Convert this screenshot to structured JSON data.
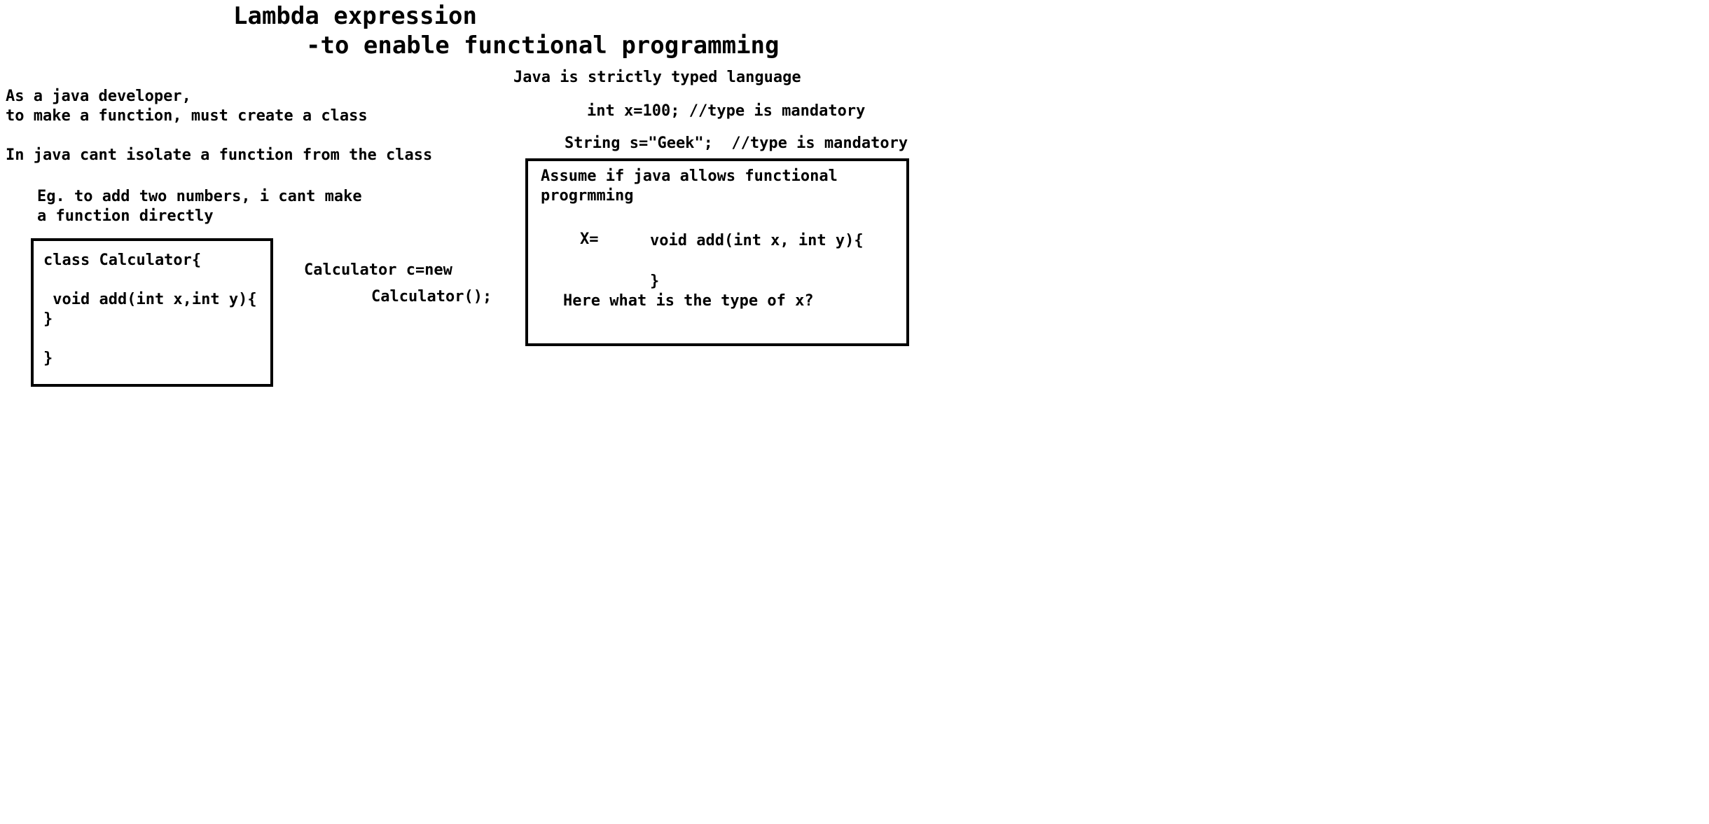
{
  "header": {
    "title": "Lambda expression",
    "subtitle": "-to enable functional programming"
  },
  "left": {
    "intro_line1": "As a java developer,",
    "intro_line2": "to make a function, must create a class",
    "isolate_note": "In java cant isolate a function from the class",
    "example_line1": "Eg. to add two numbers, i cant make",
    "example_line2": "a function directly"
  },
  "calculator_box": {
    "line1": "class Calculator{",
    "line2": " void add(int x,int y){",
    "line3": "}",
    "line4": "}"
  },
  "instantiation": {
    "line1": "Calculator c=new",
    "line2": "Calculator();"
  },
  "right": {
    "typed_note": "Java is strictly typed language",
    "int_example": "int x=100; //type is mandatory",
    "string_example": "String s=\"Geek\";  //type is mandatory"
  },
  "functional_box": {
    "line1": "Assume if java allows functional",
    "line2": "progrmming",
    "x_label": "X=",
    "method_open": "void add(int x, int y){",
    "method_close": "}",
    "question": "Here what is the type of x?"
  }
}
